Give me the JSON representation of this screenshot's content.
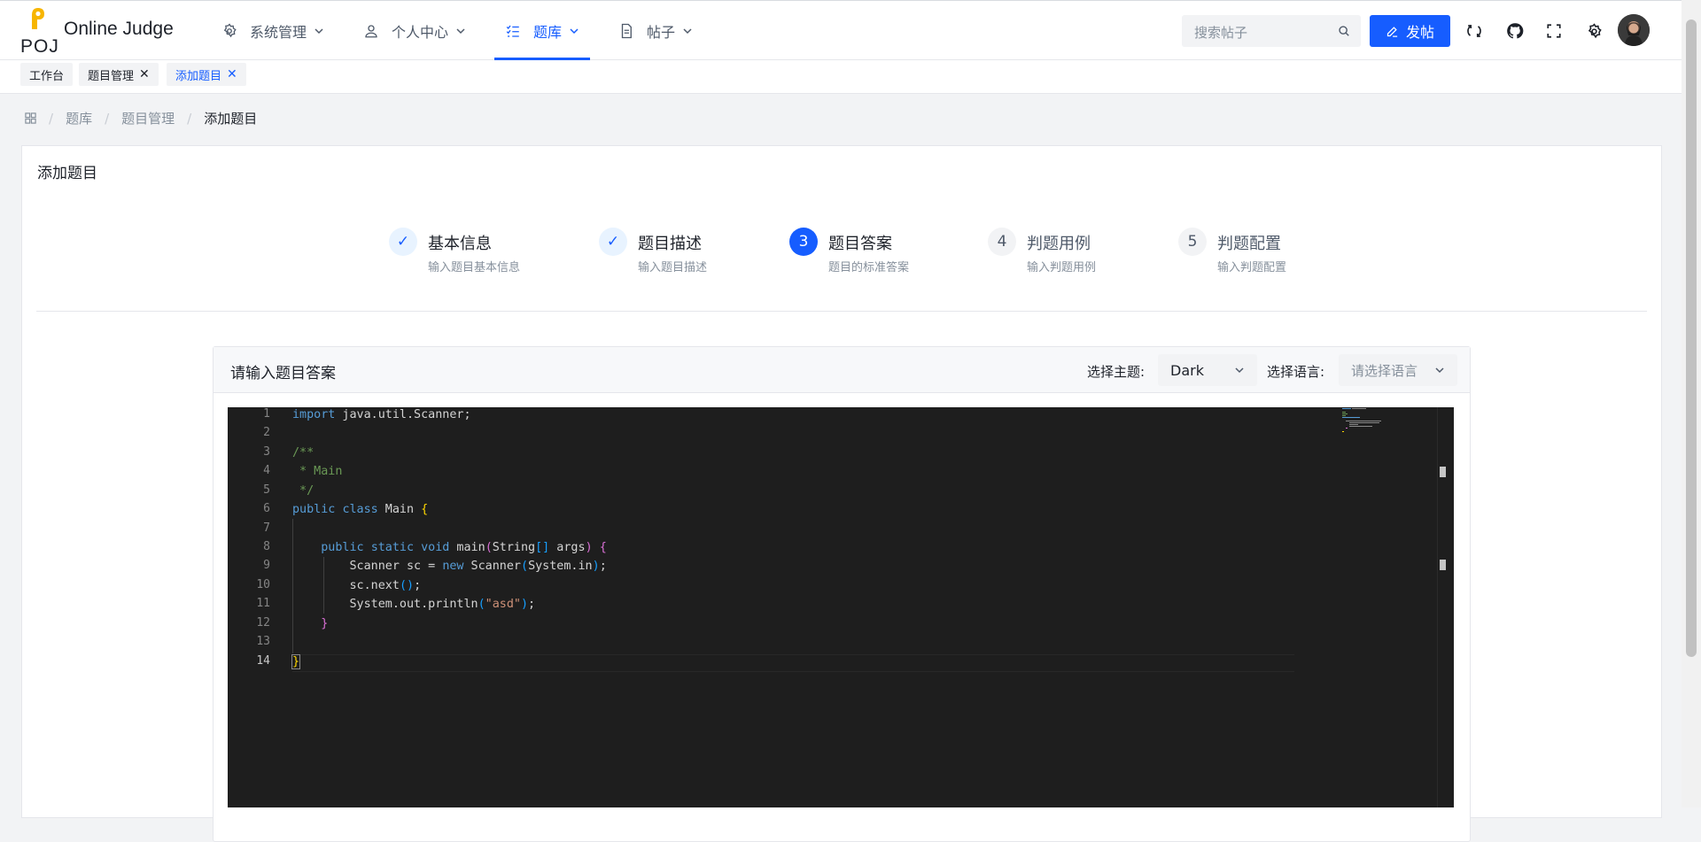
{
  "brand": {
    "logo_text": "POJ",
    "name": "Online Judge"
  },
  "nav": [
    {
      "label": "系统管理",
      "icon": "gear-icon"
    },
    {
      "label": "个人中心",
      "icon": "user-icon"
    },
    {
      "label": "题库",
      "icon": "checklist-icon",
      "active": true
    },
    {
      "label": "帖子",
      "icon": "document-icon"
    }
  ],
  "header": {
    "search_placeholder": "搜索帖子",
    "post_button": "发帖"
  },
  "tabs": [
    {
      "label": "工作台",
      "closable": false,
      "active": false
    },
    {
      "label": "题目管理",
      "closable": true,
      "active": false
    },
    {
      "label": "添加题目",
      "closable": true,
      "active": true
    }
  ],
  "breadcrumb": [
    "题库",
    "题目管理",
    "添加题目"
  ],
  "card": {
    "title": "添加题目"
  },
  "steps": [
    {
      "mark": "✓",
      "title": "基本信息",
      "desc": "输入题目基本信息",
      "state": "done"
    },
    {
      "mark": "✓",
      "title": "题目描述",
      "desc": "输入题目描述",
      "state": "done"
    },
    {
      "mark": "3",
      "title": "题目答案",
      "desc": "题目的标准答案",
      "state": "current"
    },
    {
      "mark": "4",
      "title": "判题用例",
      "desc": "输入判题用例",
      "state": "pending"
    },
    {
      "mark": "5",
      "title": "判题配置",
      "desc": "输入判题配置",
      "state": "pending"
    }
  ],
  "panel": {
    "title": "请输入题目答案",
    "theme_label": "选择主题:",
    "theme_value": "Dark",
    "lang_label": "选择语言:",
    "lang_placeholder": "请选择语言"
  },
  "editor": {
    "line_numbers": [
      "1",
      "2",
      "3",
      "4",
      "5",
      "6",
      "7",
      "8",
      "9",
      "10",
      "11",
      "12",
      "13",
      "14"
    ],
    "current_line": 14,
    "code_lines": [
      "import java.util.Scanner;",
      "",
      "/**",
      " * Main",
      " */",
      "public class Main {",
      "",
      "    public static void main(String[] args) {",
      "        Scanner sc = new Scanner(System.in);",
      "        sc.next();",
      "        System.out.println(\"asd\");",
      "    }",
      "",
      "}"
    ]
  },
  "colors": {
    "primary": "#165dff",
    "editor_bg": "#1e1e1e",
    "keyword": "#569cd6",
    "comment": "#6a9955",
    "string": "#ce9178"
  }
}
